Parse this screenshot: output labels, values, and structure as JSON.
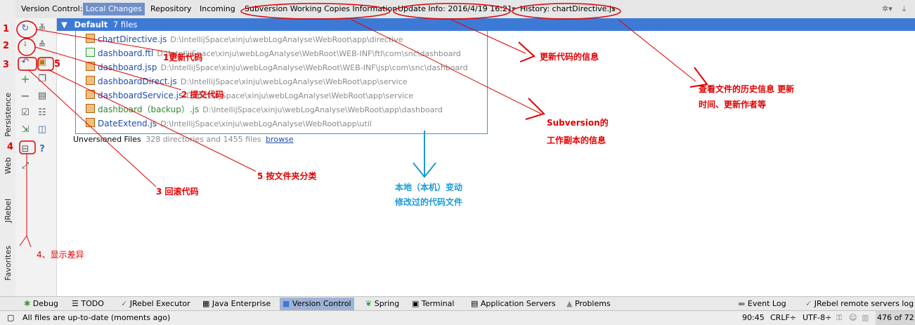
{
  "top_tabs": {
    "version_control_label": "Version Control:",
    "local_changes": "Local Changes",
    "repository": "Repository",
    "incoming": "Incoming",
    "svn_info": "Subversion Working Copies Information",
    "update_info": "Update Info: 2016/4/19 16:21",
    "history": "History: chartDirective.js"
  },
  "left_tabs": {
    "persistence": "Persistence",
    "web": "Web",
    "jrebel": "JRebel",
    "favorites": "Favorites"
  },
  "changelist": {
    "name": "Default",
    "count": "7 files"
  },
  "files": [
    {
      "name": "chartDirective.js",
      "path": "D:\\IntellijSpace\\xinju\\webLogAnalyse\\WebRoot\\app\\directive"
    },
    {
      "name": "dashboard.ftl",
      "path": "D:\\IntellijSpace\\xinju\\webLogAnalyse\\WebRoot\\WEB-INF\\ftl\\com\\snc\\dashboard"
    },
    {
      "name": "dashboard.jsp",
      "path": "D:\\IntellijSpace\\xinju\\webLogAnalyse\\WebRoot\\WEB-INF\\jsp\\com\\snc\\dashboard"
    },
    {
      "name": "dashboardDirect.js",
      "path": "D:\\IntellijSpace\\xinju\\webLogAnalyse\\WebRoot\\app\\service"
    },
    {
      "name": "dashboardService.js",
      "path": "D:\\IntellijSpace\\xinju\\webLogAnalyse\\WebRoot\\app\\service"
    },
    {
      "name": "dashboard（backup）.js",
      "path": "D:\\IntellijSpace\\xinju\\webLogAnalyse\\WebRoot\\app\\dashboard"
    },
    {
      "name": "DateExtend.js",
      "path": "D:\\IntellijSpace\\xinju\\webLogAnalyse\\WebRoot\\app\\util"
    }
  ],
  "unversioned": {
    "label": "Unversioned Files",
    "detail": "328 directories and 1455 files",
    "browse": "browse"
  },
  "annotations": {
    "update_code": "1更新代码",
    "commit_code": "2 提交代码",
    "rollback_code": "3 回滚代码",
    "show_diff": "4、显示差异",
    "group_by_folder": "5 按文件夹分类",
    "update_info": "更新代码的信息",
    "history_line1": "查看文件的历史信息 更新",
    "history_line2": "时间、更新作者等",
    "svn_line1": "Subversion的",
    "svn_line2": "工作副本的信息",
    "local_line1": "本地（本机）变动",
    "local_line2": "修改过的代码文件",
    "num1": "1",
    "num2": "2",
    "num3": "3",
    "num4": "4",
    "num5": "5"
  },
  "bottom_tabs": {
    "debug": "Debug",
    "todo": "TODO",
    "jrebel_executor": "JRebel Executor",
    "java_enterprise": "Java Enterprise",
    "version_control": "Version Control",
    "spring": "Spring",
    "terminal": "Terminal",
    "app_servers": "Application Servers",
    "problems": "Problems",
    "event_log": "Event Log",
    "jrebel_remote": "JRebel remote servers log"
  },
  "status": {
    "message": "All files are up-to-date (moments ago)",
    "position": "90:45",
    "line_sep": "CRLF÷",
    "encoding": "UTF-8÷",
    "memory": "476 of 72"
  },
  "colors": {
    "accent": "#3d7ad6",
    "annotation_red": "#e00000",
    "annotation_blue": "#1a9ad6"
  }
}
